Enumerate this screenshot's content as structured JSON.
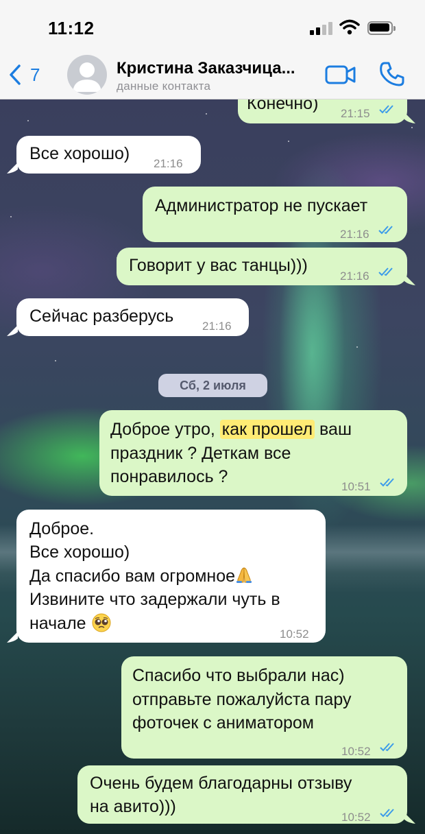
{
  "status_bar": {
    "time": "11:12"
  },
  "header": {
    "back_count": "7",
    "contact_name": "Кристина Заказчица...",
    "contact_subtitle": "данные контакта"
  },
  "date_separator": "Сб, 2 июля",
  "messages": [
    {
      "side": "out",
      "text": "Конечно)",
      "time": "21:15",
      "read": true
    },
    {
      "side": "in",
      "text": "Все хорошо)",
      "time": "21:16"
    },
    {
      "side": "out",
      "text": "Администратор не пускает",
      "time": "21:16",
      "read": true
    },
    {
      "side": "out",
      "text": "Говорит у вас танцы)))",
      "time": "21:16",
      "read": true
    },
    {
      "side": "in",
      "text": "Сейчас разберусь",
      "time": "21:16"
    },
    {
      "side": "out",
      "text_before": "Доброе утро, ",
      "highlight": "как прошел",
      "text_after": " ваш",
      "line2": "праздник ? Деткам все",
      "line3": "понравилось ?",
      "time": "10:51",
      "read": true
    },
    {
      "side": "in",
      "line1": "Доброе.",
      "line2": "Все хорошо)",
      "line3": "Да спасибо вам огромное",
      "line4": "Извините что задержали чуть в",
      "line5": "начале",
      "emoji1": "folded-hands",
      "emoji2": "pleading-face",
      "time": "10:52"
    },
    {
      "side": "out",
      "line1": "Спасибо что выбрали нас)",
      "line2": "отправьте пожалуйста пару",
      "line3": "фоточек с аниматором",
      "time": "10:52",
      "read": true
    },
    {
      "side": "out",
      "line1": "Очень будем благодарны отзыву",
      "line2": "на авито)))",
      "time": "10:52",
      "read": true
    }
  ],
  "colors": {
    "accent": "#1c7de0",
    "outgoing_bubble": "#dbf7c7",
    "incoming_bubble": "#ffffff",
    "read_check": "#3b9bea",
    "highlight": "#ffeb74"
  }
}
